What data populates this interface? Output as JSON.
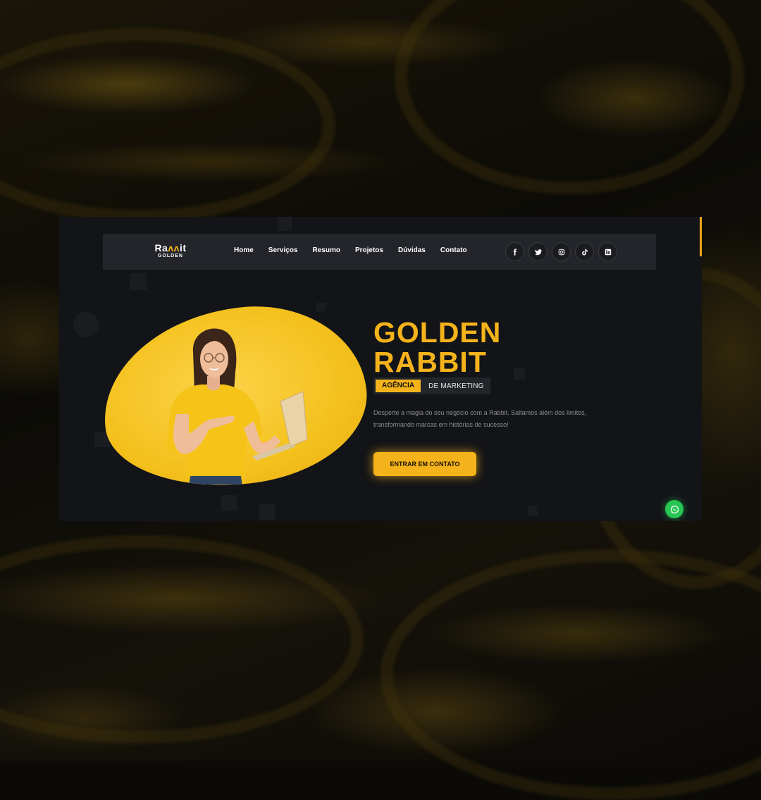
{
  "brand": {
    "logo_main_left": "Ra",
    "logo_main_ears": "ʌʌ",
    "logo_main_right": "it",
    "logo_sub": "GOLDEN"
  },
  "nav": {
    "links": [
      "Home",
      "Serviços",
      "Resumo",
      "Projetos",
      "Dúvidas",
      "Contato"
    ]
  },
  "socials": [
    "facebook-icon",
    "twitter-icon",
    "instagram-icon",
    "tiktok-icon",
    "linkedin-icon"
  ],
  "hero": {
    "title_line1": "GOLDEN",
    "title_line2": "RABBIT",
    "badge_highlight": "AGÊNCIA",
    "badge_rest": "DE MARKETING",
    "description_line1": "Desperte a magia do seu negócio com a Rabbit. Saltamos além dos limites,",
    "description_line2": "transformando marcas em histórias de sucesso!",
    "cta_label": "ENTRAR EM CONTATO"
  },
  "colors": {
    "accent": "#f5b31b",
    "page_background": "#131418",
    "navbar": "#24252a",
    "whatsapp": "#27c552"
  },
  "floating": {
    "whatsapp_icon": "whatsapp-icon"
  }
}
